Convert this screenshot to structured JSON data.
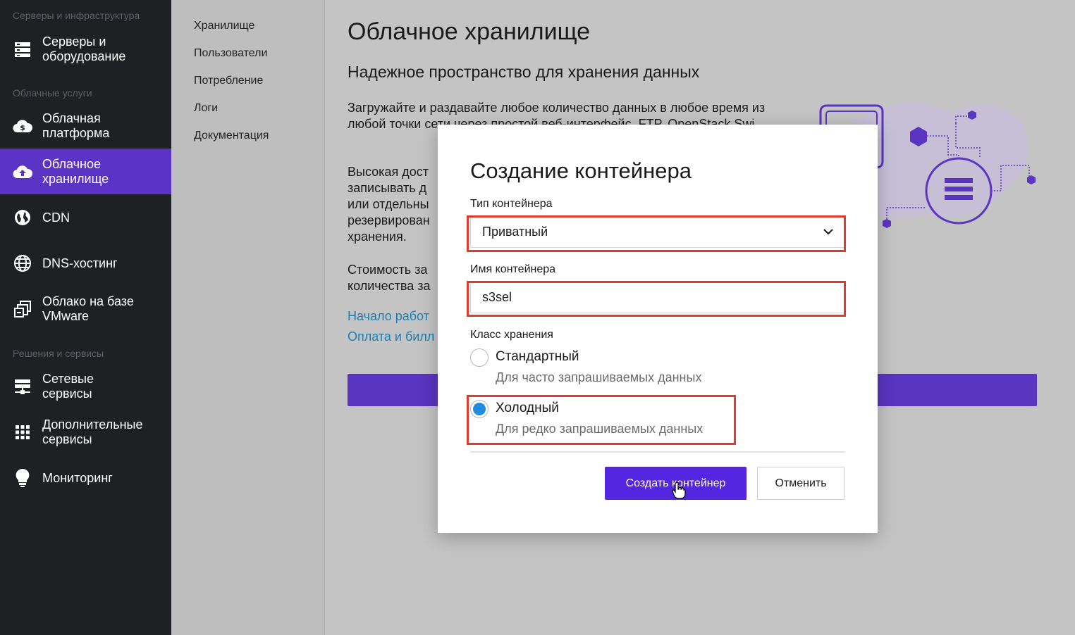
{
  "sidebar": {
    "sections": [
      "Серверы и инфраструктура",
      "Облачные услуги",
      "Решения и сервисы"
    ],
    "items": [
      {
        "label": "Серверы и\nоборудование",
        "icon": "server-icon"
      },
      {
        "label": "Облачная\nплатформа",
        "icon": "cloud-platform-icon"
      },
      {
        "label": "Облачное\nхранилище",
        "icon": "cloud-upload-icon",
        "active": true
      },
      {
        "label": "CDN",
        "icon": "globe-icon"
      },
      {
        "label": "DNS-хостинг",
        "icon": "web-icon"
      },
      {
        "label": "Облако на базе\nVMware",
        "icon": "vmware-icon"
      },
      {
        "label": "Сетевые\nсервисы",
        "icon": "network-icon"
      },
      {
        "label": "Дополнительные\nсервисы",
        "icon": "grid-icon"
      },
      {
        "label": "Мониторинг",
        "icon": "bulb-icon"
      }
    ],
    "active_color": "#5b34c6"
  },
  "submenu": {
    "items": [
      "Хранилище",
      "Пользователи",
      "Потребление",
      "Логи",
      "Документация"
    ]
  },
  "main": {
    "title": "Облачное хранилище",
    "subtitle": "Надежное пространство для хранения данных",
    "para1": "Загружайте и раздавайте любое количество данных в любое время из любой точки сети через простой веб-интерфейс, FTP, OpenStack Swi",
    "para2": "Высокая дост\nзаписывать д\nили отдельны\nрезервирован\nхранения.",
    "para3": "Стоимость за\nколичества за",
    "link1": "Начало работ",
    "link2": "Оплата и билл",
    "accent": "#5a35c1"
  },
  "modal": {
    "title": "Создание контейнера",
    "type_label": "Тип контейнера",
    "type_value": "Приватный",
    "name_label": "Имя контейнера",
    "name_value": "s3sel",
    "class_label": "Класс хранения",
    "options": [
      {
        "title": "Стандартный",
        "desc": "Для часто запрашиваемых данных",
        "checked": false
      },
      {
        "title": "Холодный",
        "desc": "Для редко запрашиваемых данных",
        "checked": true
      }
    ],
    "create_button": "Создать контейнер",
    "cancel_button": "Отменить",
    "primary_color": "#5426e0",
    "highlight_color": "#e03c2e"
  }
}
